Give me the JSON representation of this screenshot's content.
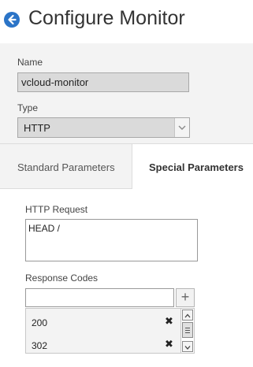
{
  "header": {
    "title": "Configure Monitor",
    "back_icon": "back-arrow-icon"
  },
  "form": {
    "name_label": "Name",
    "name_value": "vcloud-monitor",
    "type_label": "Type",
    "type_value": "HTTP"
  },
  "tabs": [
    {
      "label": "Standard Parameters",
      "active": false
    },
    {
      "label": "Special Parameters",
      "active": true
    }
  ],
  "special": {
    "http_request_label": "HTTP Request",
    "http_request_value": "HEAD /",
    "response_codes_label": "Response Codes",
    "response_code_input": "",
    "add_symbol": "+",
    "codes": [
      {
        "value": "200",
        "remove": "✖"
      },
      {
        "value": "302",
        "remove": "✖"
      }
    ]
  },
  "colors": {
    "accent": "#2b74c7",
    "section_bg": "#f3f3f3",
    "input_disabled_bg": "#dadada"
  }
}
